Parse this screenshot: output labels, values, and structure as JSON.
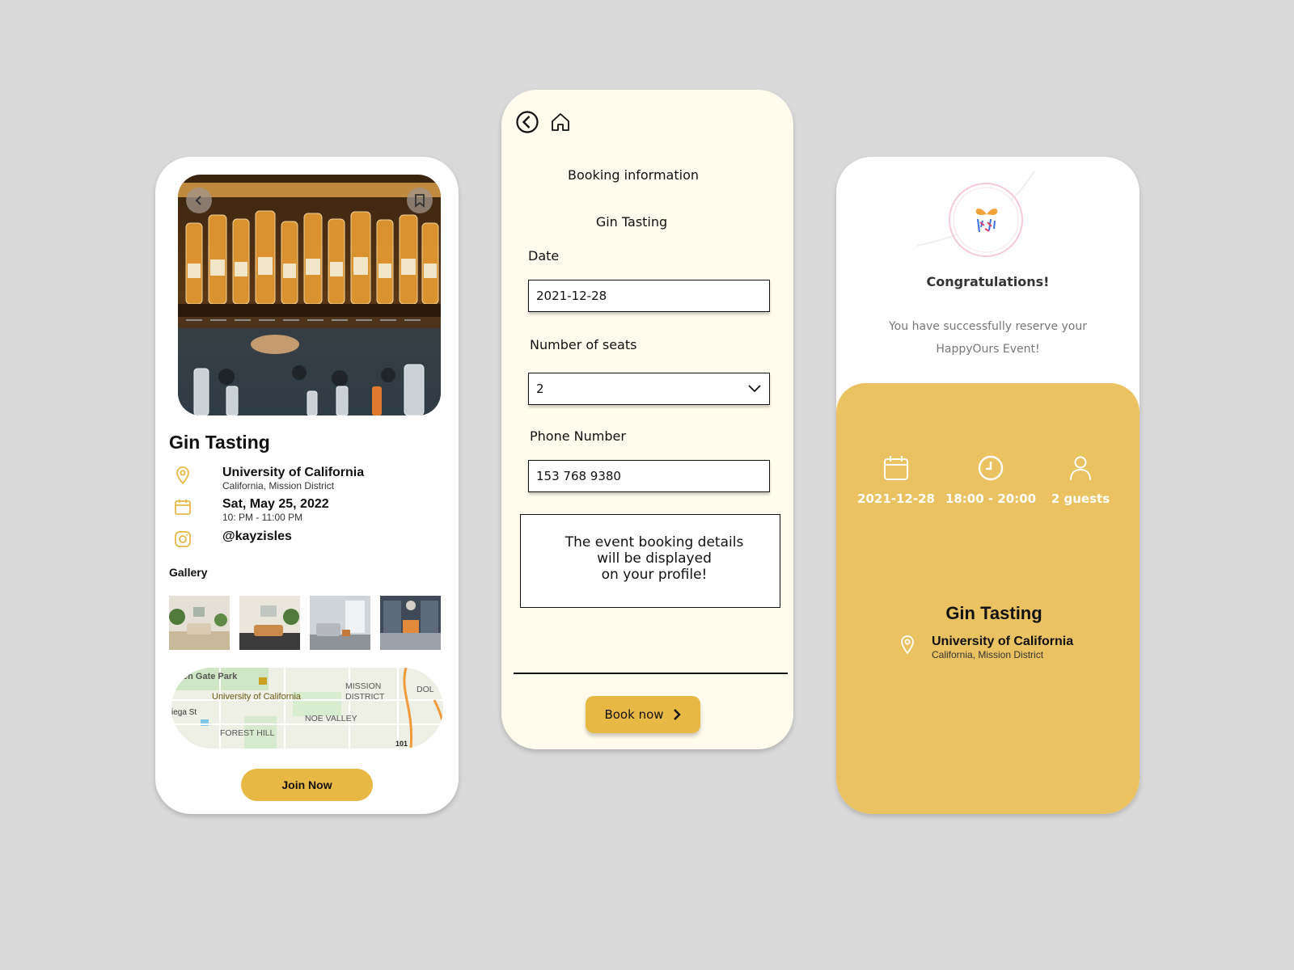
{
  "event_details": {
    "title": "Gin Tasting",
    "location_name": "University of California",
    "location_sub": "California, Mission District",
    "date": "Sat, May 25, 2022",
    "time": "10: PM - 11:00 PM",
    "instagram": "@kayzisles",
    "gallery_label": "Gallery",
    "map_labels": {
      "park": "en Gate Park",
      "university": "University of California",
      "mission": "MISSION",
      "district": "DISTRICT",
      "dol": "DOL",
      "street": "iega St",
      "noe": "NOE VALLEY",
      "forest": "FOREST HILL",
      "highway": "101"
    },
    "join_button": "Join Now"
  },
  "booking": {
    "heading": "Booking information",
    "event_name": "Gin Tasting",
    "date_label": "Date",
    "date_value": "2021-12-28",
    "seats_label": "Number of seats",
    "seats_value": "2",
    "phone_label": "Phone Number",
    "phone_value": "153 768 9380",
    "notice_lines": [
      "The event booking details",
      "will be displayed",
      "on your profile!"
    ],
    "book_button": "Book now"
  },
  "confirmation": {
    "title": "Congratulations!",
    "message_line1": "You have successfully reserve your",
    "message_line2": "HappyOurs Event!",
    "date": "2021-12-28",
    "time": "18:00 - 20:00",
    "guests": "2 guests",
    "event_title": "Gin Tasting",
    "location_name": "University of California",
    "location_sub": "California, Mission District"
  },
  "colors": {
    "accent": "#e8b845",
    "panel": "#eac261",
    "booking_bg": "#fffcee",
    "background": "#d9d9d9"
  }
}
